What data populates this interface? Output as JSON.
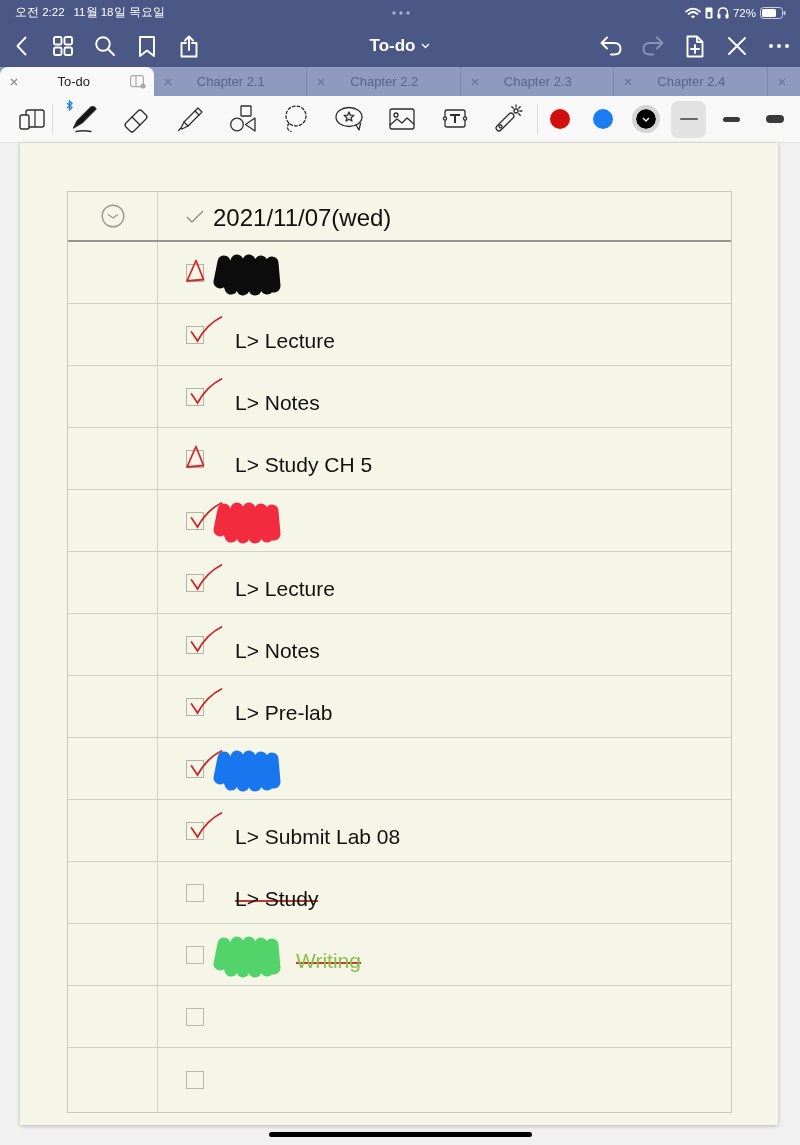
{
  "status_bar": {
    "time": "오전 2:22",
    "date": "11월 18일 목요일",
    "battery": "72%"
  },
  "nav_bar": {
    "title": "To-do",
    "left_buttons": [
      {
        "kind": "back"
      },
      {
        "kind": "grid"
      },
      {
        "kind": "search"
      },
      {
        "kind": "bookmark"
      },
      {
        "kind": "share"
      }
    ],
    "right_buttons": [
      {
        "kind": "undo",
        "disabled": false
      },
      {
        "kind": "redo",
        "disabled": true
      },
      {
        "kind": "add_page",
        "disabled": false
      },
      {
        "kind": "crossed",
        "disabled": false
      },
      {
        "kind": "more",
        "disabled": false
      }
    ]
  },
  "tabs": [
    {
      "label": "To-do",
      "selected": true
    },
    {
      "label": "Chapter 2.1",
      "selected": false
    },
    {
      "label": "Chapter 2.2",
      "selected": false
    },
    {
      "label": "Chapter 2.3",
      "selected": false
    },
    {
      "label": "Chapter 2.4",
      "selected": false
    },
    {
      "selected": false
    }
  ],
  "toolbar": {
    "tools": [
      {
        "kind": "pen",
        "selected": true,
        "bluetooth": true
      },
      {
        "kind": "eraser",
        "selected": false,
        "bluetooth": false
      },
      {
        "kind": "highlighter",
        "selected": false,
        "bluetooth": false
      },
      {
        "kind": "shapes",
        "selected": false,
        "bluetooth": false
      },
      {
        "kind": "lasso",
        "selected": false,
        "bluetooth": false
      },
      {
        "kind": "sticker",
        "selected": false,
        "bluetooth": false
      },
      {
        "kind": "image",
        "selected": false,
        "bluetooth": false
      },
      {
        "kind": "text",
        "selected": false,
        "bluetooth": false
      },
      {
        "kind": "laser",
        "selected": false,
        "bluetooth": false
      }
    ],
    "colors": [
      {
        "color": "#d10f0f",
        "selected": false
      },
      {
        "color": "#1a7ef2",
        "selected": false
      },
      {
        "color": "#000000",
        "selected": true
      }
    ],
    "stroke_widths": [
      {
        "kind": "thin",
        "selected": true
      },
      {
        "kind": "medium",
        "selected": false
      },
      {
        "kind": "thick",
        "selected": false
      }
    ]
  },
  "page": {
    "header": {
      "date": "2021/11/07(wed)"
    },
    "rows": [
      {
        "checked": true,
        "partial": true,
        "scribble": {
          "color": "#0c0c0c"
        }
      },
      {
        "checked": true,
        "partial": false,
        "text": "L> Lecture",
        "color": "#111111",
        "struck": false
      },
      {
        "checked": true,
        "partial": false,
        "text": "L> Notes",
        "color": "#111111",
        "struck": false
      },
      {
        "checked": true,
        "partial": true,
        "text": "L> Study CH 5",
        "color": "#111111",
        "struck": false
      },
      {
        "checked": true,
        "partial": false,
        "scribble": {
          "color": "#f32b3e"
        }
      },
      {
        "checked": true,
        "partial": false,
        "text": "L> Lecture",
        "color": "#111111",
        "struck": false
      },
      {
        "checked": true,
        "partial": false,
        "text": "L> Notes",
        "color": "#111111",
        "struck": false
      },
      {
        "checked": true,
        "partial": false,
        "text": "L> Pre-lab",
        "color": "#111111",
        "struck": false
      },
      {
        "checked": true,
        "partial": false,
        "scribble": {
          "color": "#1877ee"
        }
      },
      {
        "checked": true,
        "partial": false,
        "text": "L> Submit Lab 08",
        "color": "#111111",
        "struck": false
      },
      {
        "checked": false,
        "partial": false,
        "text": "L> Study",
        "color": "#111111",
        "struck": true
      },
      {
        "checked": false,
        "partial": false,
        "scribble": {
          "color": "#52d46a"
        },
        "text": "Writing",
        "color": "#8cc04a",
        "struck": true
      },
      {
        "checked": false,
        "partial": false
      },
      {
        "checked": false,
        "partial": false
      }
    ]
  }
}
